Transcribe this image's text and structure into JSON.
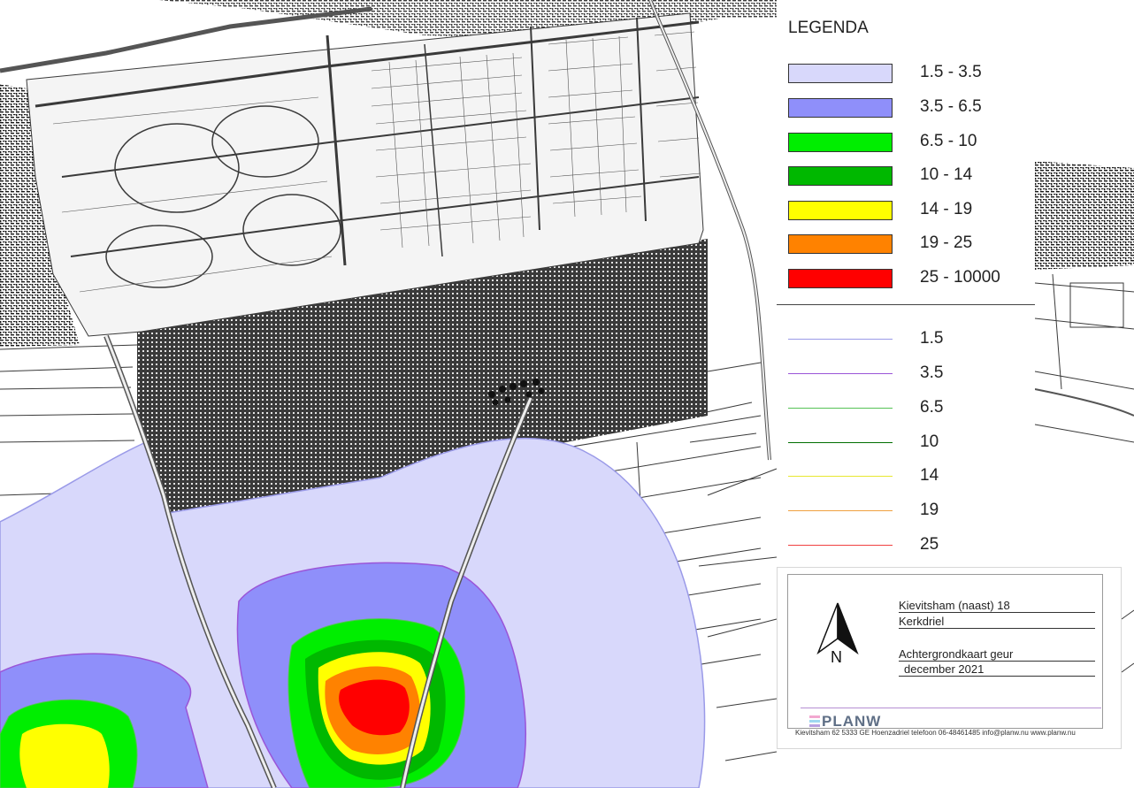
{
  "legend": {
    "title": "LEGENDA",
    "classes": [
      {
        "label": "1.5 - 3.5",
        "color": "#d8d8fb"
      },
      {
        "label": "3.5 - 6.5",
        "color": "#8f8ffa"
      },
      {
        "label": "6.5 - 10",
        "color": "#00ee00"
      },
      {
        "label": "10 - 14",
        "color": "#00b800"
      },
      {
        "label": "14 - 19",
        "color": "#ffff00"
      },
      {
        "label": "19 - 25",
        "color": "#ff8200"
      },
      {
        "label": "25 - 10000",
        "color": "#ff0000"
      }
    ],
    "contours": [
      {
        "label": "1.5",
        "color": "#9a9ae8"
      },
      {
        "label": "3.5",
        "color": "#9a55d8"
      },
      {
        "label": "6.5",
        "color": "#55c255"
      },
      {
        "label": "10",
        "color": "#006e00"
      },
      {
        "label": "14",
        "color": "#e8e830"
      },
      {
        "label": "19",
        "color": "#f0a040"
      },
      {
        "label": "25",
        "color": "#f04040"
      }
    ]
  },
  "title_block": {
    "line1": "Kievitsham (naast) 18",
    "line2": "Kerkdriel",
    "line3": "Achtergrondkaart geur",
    "line4": "december 2021",
    "north_label": "N",
    "logo_text": "PLANW",
    "address": "Kievitsham 62 5333 GE Hoenzadriel telefoon 06-48461485 info@planw.nu www.planw.nu"
  },
  "colors": {
    "parcel_lines": "#3a3a3a",
    "urban_hatch": "#1a1a1a",
    "logo_bars": [
      "#f2a8d0",
      "#9fd8f0",
      "#b8a0e0"
    ]
  }
}
